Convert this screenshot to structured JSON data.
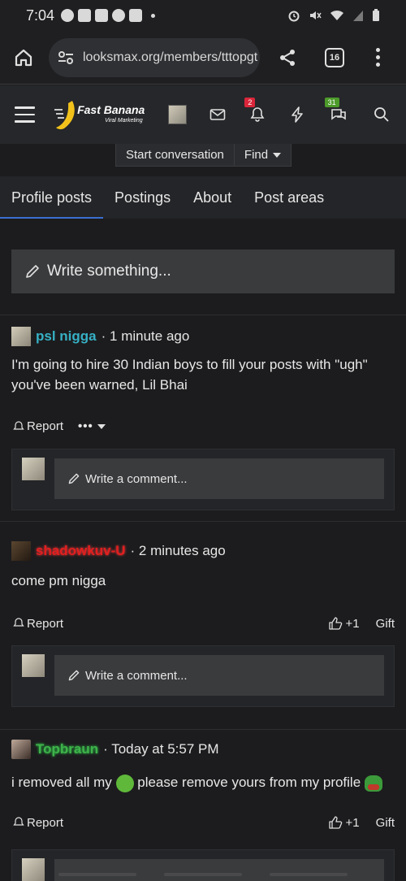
{
  "status_bar": {
    "time": "7:04"
  },
  "browser": {
    "url": "looksmax.org/members/tttopgt",
    "tab_count": "16"
  },
  "header": {
    "logo_text": "Fast Banana",
    "logo_subtext": "Viral Marketing",
    "alerts_count": "2",
    "conversations_count": "31"
  },
  "sub_actions": {
    "start_conversation": "Start conversation",
    "find": "Find"
  },
  "tabs": [
    {
      "label": "Profile posts"
    },
    {
      "label": "Postings"
    },
    {
      "label": "About"
    },
    {
      "label": "Post areas"
    }
  ],
  "write_placeholder": "Write something...",
  "comment_placeholder": "Write a comment...",
  "posts": [
    {
      "username": "psl nigga",
      "time": "1 minute ago",
      "body": "I'm going to hire 30 Indian boys to fill your posts with \"ugh\" you've been warned, Lil Bhai",
      "report": "Report"
    },
    {
      "username": "shadowkuv-U",
      "time": "2 minutes ago",
      "body": "come pm nigga",
      "report": "Report",
      "likes": "+1",
      "gift": "Gift"
    },
    {
      "username": "Topbraun",
      "time": "Today at 5:57 PM",
      "body_before": "i removed all my",
      "body_after": "please remove yours from my profile",
      "report": "Report",
      "likes": "+1",
      "gift": "Gift"
    }
  ]
}
